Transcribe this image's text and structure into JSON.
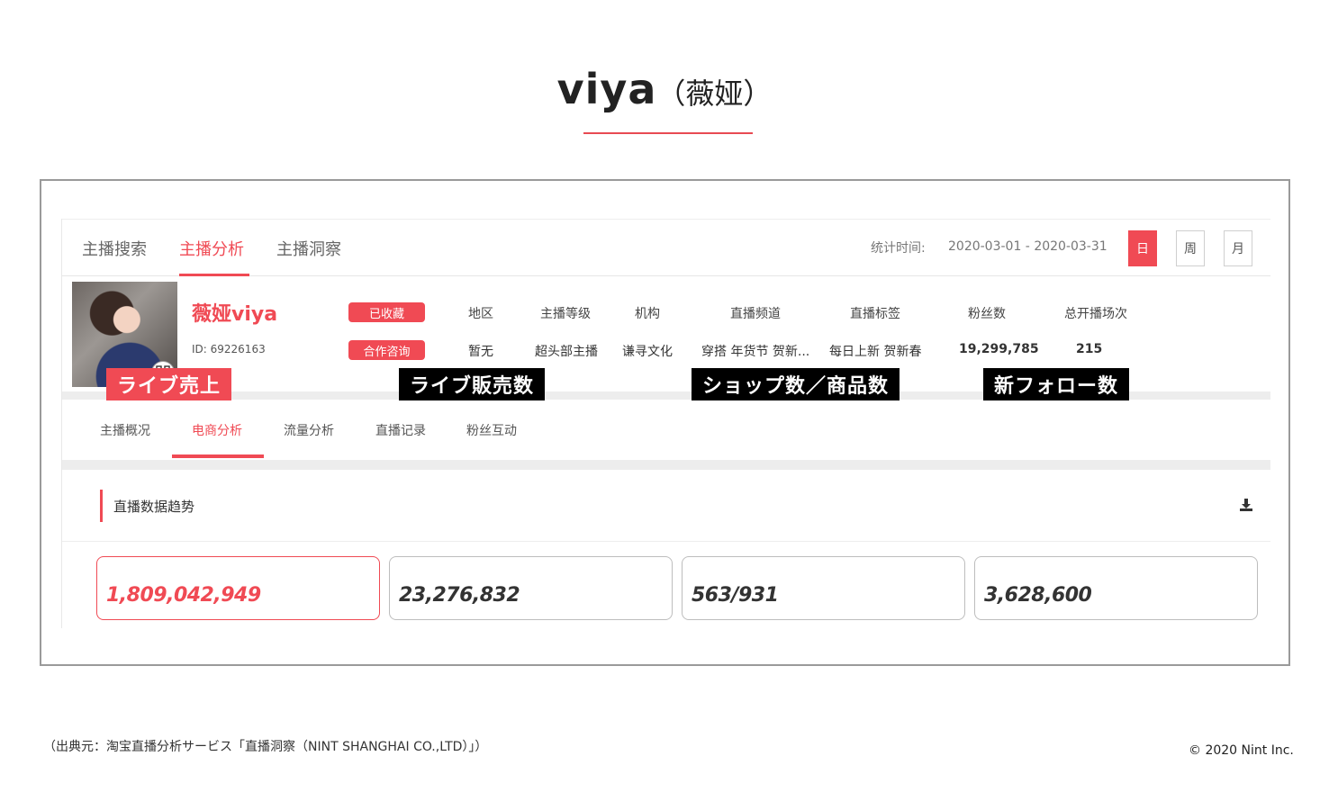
{
  "slide": {
    "title_main": "viya",
    "title_sub": "（薇娅）",
    "footnote": "（出典元：淘宝直播分析サービス「直播洞察（NINT SHANGHAI CO.,LTD）」）",
    "copyright": "© 2020 Nint Inc."
  },
  "topnav": {
    "tabs": [
      "主播搜索",
      "主播分析",
      "主播洞察"
    ],
    "active_tab": "主播分析",
    "stat_label": "统计时间:",
    "stat_range": "2020-03-01 - 2020-03-31",
    "periods": [
      "日",
      "周",
      "月"
    ],
    "active_period": "日"
  },
  "profile": {
    "name": "薇娅viya",
    "id_text": "ID: 69226163",
    "favorite_label": "已收藏",
    "consult_label": "合作咨询",
    "columns": [
      {
        "header": "地区",
        "value": "暂无"
      },
      {
        "header": "主播等级",
        "value": "超头部主播"
      },
      {
        "header": "机构",
        "value": "谦寻文化"
      },
      {
        "header": "直播频道",
        "value": "穿搭 年货节 贺新..."
      },
      {
        "header": "直播标签",
        "value": "每日上新 贺新春"
      },
      {
        "header": "粉丝数",
        "value": "19,299,785"
      },
      {
        "header": "总开播场次",
        "value": "215"
      }
    ]
  },
  "subtabs": {
    "items": [
      "主播概况",
      "电商分析",
      "流量分析",
      "直播记录",
      "粉丝互动"
    ],
    "active": "电商分析"
  },
  "section": {
    "title": "直播数据趋势"
  },
  "cards": [
    {
      "label": "ライブ売上",
      "value": "1,809,042,949"
    },
    {
      "label": "ライブ販売数",
      "value": "23,276,832"
    },
    {
      "label": "ショップ数／商品数",
      "value": "563/931"
    },
    {
      "label": "新フォロー数",
      "value": "3,628,600"
    }
  ],
  "colors": {
    "accent": "#f04a54",
    "label_bg": "#000000"
  }
}
